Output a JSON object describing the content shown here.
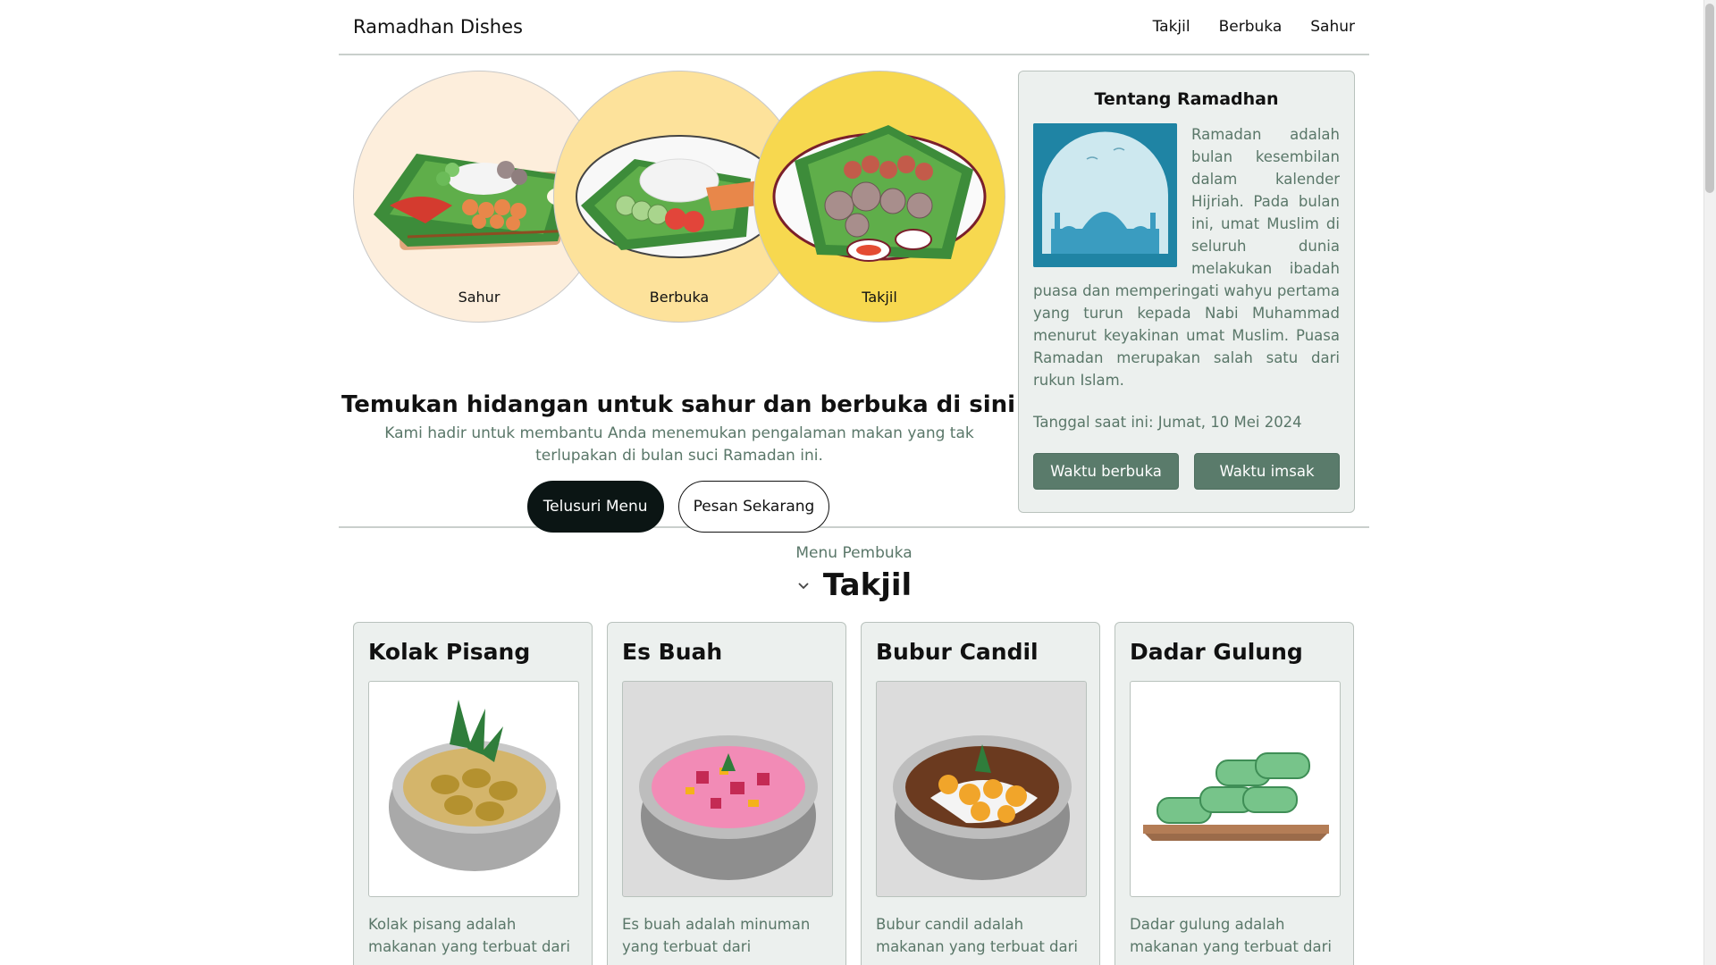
{
  "header": {
    "brand": "Ramadhan Dishes",
    "nav": [
      "Takjil",
      "Berbuka",
      "Sahur"
    ]
  },
  "hero": {
    "circles": [
      {
        "label": "Sahur",
        "color": "#fdeedc"
      },
      {
        "label": "Berbuka",
        "color": "#fde29b"
      },
      {
        "label": "Takjil",
        "color": "#f7d84f"
      }
    ],
    "title": "Temukan hidangan untuk sahur dan berbuka di sini",
    "subtitle": "Kami hadir untuk membantu Anda menemukan pengalaman makan yang tak terlupakan di bulan suci Ramadan ini.",
    "primary_button": "Telusuri Menu",
    "secondary_button": "Pesan Sekarang"
  },
  "about": {
    "title": "Tentang Ramadhan",
    "body": "Ramadan adalah bulan kesembilan dalam kalender Hijriah. Pada bulan ini, umat Muslim di seluruh dunia melakukan ibadah puasa dan memperingati wahyu pertama yang turun kepada Nabi Muhammad menurut keyakinan umat Muslim. Puasa Ramadan merupakan salah satu dari rukun Islam.",
    "date": "Tanggal saat ini: Jumat, 10 Mei 2024",
    "button_iftar": "Waktu berbuka",
    "button_imsak": "Waktu imsak"
  },
  "menu": {
    "kicker": "Menu Pembuka",
    "heading": "Takjil",
    "cards": [
      {
        "title": "Kolak Pisang",
        "desc": "Kolak pisang adalah makanan yang terbuat dari"
      },
      {
        "title": "Es Buah",
        "desc": "Es buah adalah minuman yang terbuat dari campuran"
      },
      {
        "title": "Bubur Candil",
        "desc": "Bubur candil adalah makanan yang terbuat dari"
      },
      {
        "title": "Dadar Gulung",
        "desc": "Dadar gulung adalah makanan yang terbuat dari"
      }
    ]
  },
  "colors": {
    "accent_green": "#5a7b6b",
    "text_muted": "#5a7769",
    "panel_bg": "#ecf0ee",
    "primary_button": "#0b1514"
  }
}
